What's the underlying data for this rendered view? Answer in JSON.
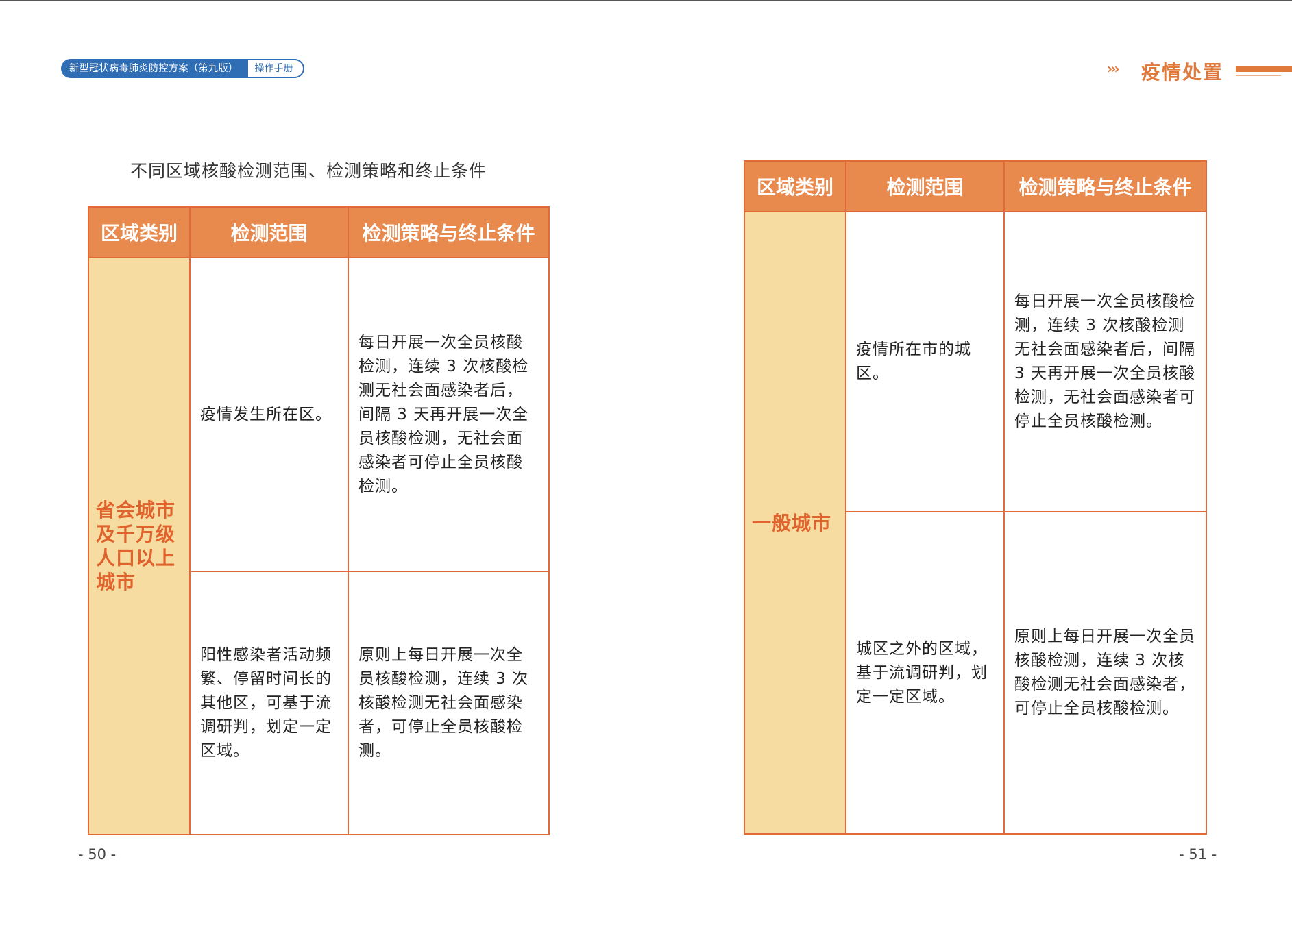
{
  "header_left": {
    "title": "新型冠状病毒肺炎防控方案（第九版）",
    "tag": "操作手册"
  },
  "header_right": {
    "section": "疫情处置"
  },
  "left_page": {
    "caption": "不同区域核酸检测范围、检测策略和终止条件",
    "columns": [
      "区域类别",
      "检测范围",
      "检测策略与终止条件"
    ],
    "category": "省会城市及千万级人口以上城市",
    "rows": [
      {
        "scope": "疫情发生所在区。",
        "strategy": "每日开展一次全员核酸检测，连续 3 次核酸检测无社会面感染者后，间隔 3 天再开展一次全员核酸检测，无社会面感染者可停止全员核酸检测。"
      },
      {
        "scope": "阳性感染者活动频繁、停留时间长的其他区，可基于流调研判，划定一定区域。",
        "strategy": "原则上每日开展一次全员核酸检测，连续 3 次核酸检测无社会面感染者，可停止全员核酸检测。"
      }
    ],
    "page_number": "- 50 -"
  },
  "right_page": {
    "columns": [
      "区域类别",
      "检测范围",
      "检测策略与终止条件"
    ],
    "category": "一般城市",
    "rows": [
      {
        "scope": "疫情所在市的城区。",
        "strategy": "每日开展一次全员核酸检测，连续 3 次核酸检测无社会面感染者后，间隔 3 天再开展一次全员核酸检测，无社会面感染者可停止全员核酸检测。"
      },
      {
        "scope": "城区之外的区域，基于流调研判，划定一定区域。",
        "strategy": "原则上每日开展一次全员核酸检测，连续 3 次核酸检测无社会面感染者，可停止全员核酸检测。"
      }
    ],
    "page_number": "- 51 -"
  },
  "colors": {
    "header_orange": "#e8894e",
    "border_orange": "#e06a3a",
    "category_fill": "#f6dca0",
    "category_text": "#e0622d",
    "badge_blue": "#2f6db5"
  }
}
